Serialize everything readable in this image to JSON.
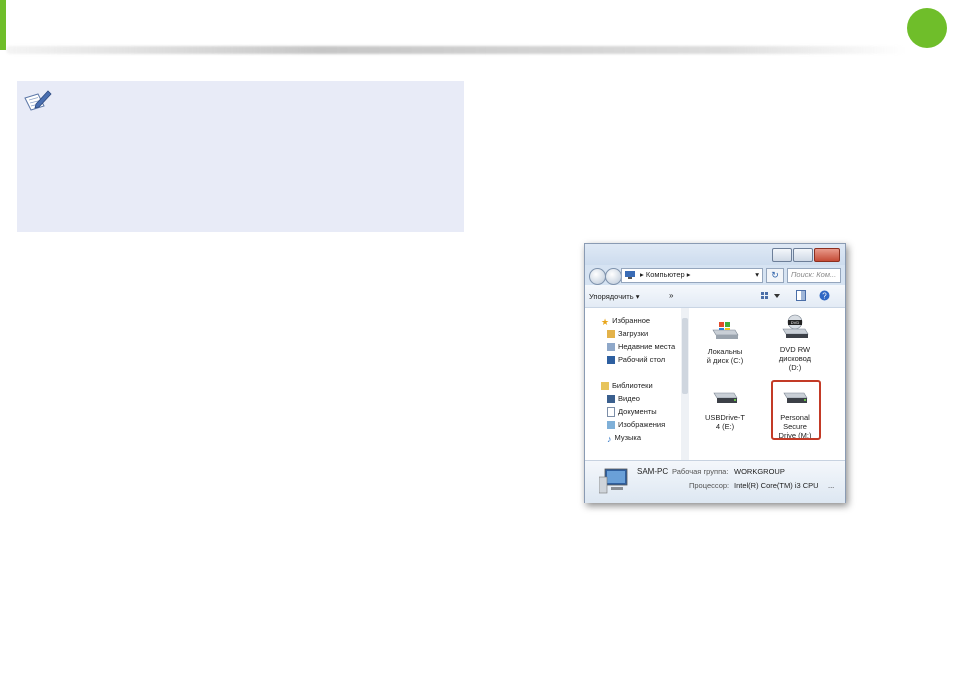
{
  "page": {
    "accent_color": "#6fbe2a",
    "note_bg_color": "#e8ebf7",
    "highlight_color": "#c33a26"
  },
  "note": {
    "icon": "note-pencil-icon"
  },
  "explorer": {
    "address_path": "Компьютер",
    "search_placeholder": "Поиск: Ком...",
    "toolbar": {
      "organize_label": "Упорядочить",
      "more_label": "»"
    },
    "sidebar": {
      "favorites": {
        "label": "Избранное",
        "items": [
          {
            "label": "Загрузки",
            "icon": "downloads-icon"
          },
          {
            "label": "Недавние места",
            "icon": "recent-places-icon"
          },
          {
            "label": "Рабочий стол",
            "icon": "desktop-icon"
          }
        ]
      },
      "libraries": {
        "label": "Библиотеки",
        "items": [
          {
            "label": "Видео",
            "icon": "video-icon"
          },
          {
            "label": "Документы",
            "icon": "documents-icon"
          },
          {
            "label": "Изображения",
            "icon": "pictures-icon"
          },
          {
            "label": "Музыка",
            "icon": "music-icon"
          }
        ]
      }
    },
    "drives": [
      {
        "line1": "Локальны",
        "line2": "й диск (C:)",
        "line3": "",
        "icon": "local-disk-icon"
      },
      {
        "line1": "DVD RW",
        "line2": "дисковод",
        "line3": "(D:)",
        "icon": "dvd-drive-icon"
      },
      {
        "line1": "USBDrive-T",
        "line2": "4 (E:)",
        "line3": "",
        "icon": "usb-drive-icon"
      },
      {
        "line1": "Personal",
        "line2": "Secure",
        "line3": "Drive (M:)",
        "icon": "secure-drive-icon"
      }
    ],
    "details": {
      "computer_name": "SAM-PC",
      "workgroup_label": "Рабочая группа:",
      "workgroup_value": "WORKGROUP",
      "processor_label": "Процессор:",
      "processor_value": "Intel(R) Core(TM) i3 CPU",
      "ellipsis": "..."
    }
  }
}
